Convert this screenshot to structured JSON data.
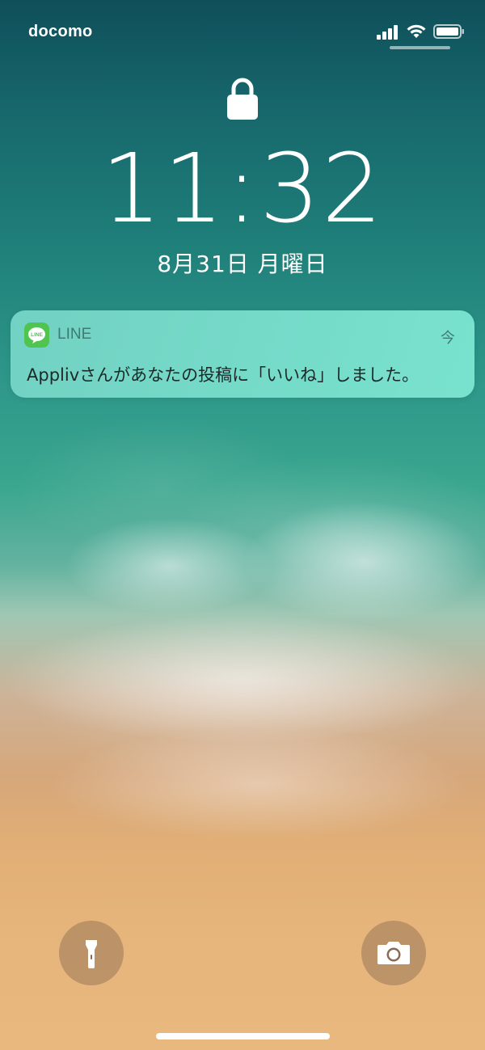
{
  "status_bar": {
    "carrier": "docomo",
    "signal_icon": "cellular-signal-icon",
    "wifi_icon": "wifi-icon",
    "battery_icon": "battery-icon"
  },
  "lock_screen": {
    "lock_icon": "lock-icon",
    "time": "11:32",
    "date": "8月31日 月曜日"
  },
  "notification": {
    "app_icon": "line-app-icon",
    "app_icon_text": "LINE",
    "app_name": "LINE",
    "time": "今",
    "message": "Applivさんがあなたの投稿に「いいね」しました。"
  },
  "quick_actions": {
    "flashlight_icon": "flashlight-icon",
    "camera_icon": "camera-icon"
  },
  "colors": {
    "line_green": "#4fc54f",
    "notification_bg": "#7fe0cf"
  }
}
